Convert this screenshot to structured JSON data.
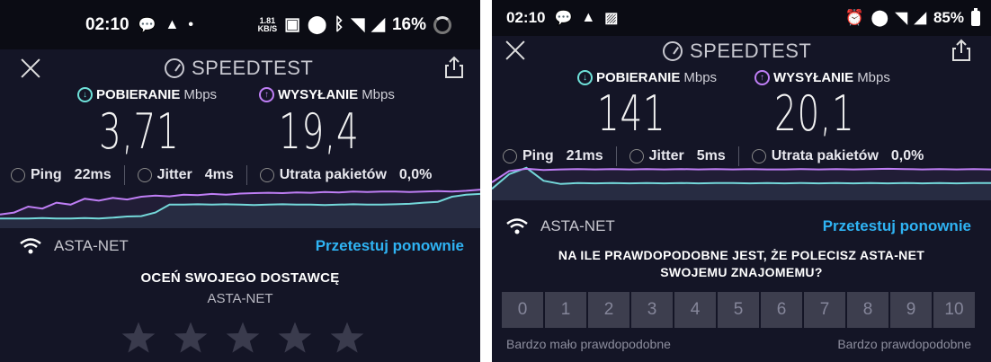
{
  "screens": [
    {
      "status": {
        "time": "02:10",
        "net_speed_top": "1.81",
        "net_speed_unit": "KB/S",
        "battery": "16%"
      },
      "app": {
        "brand": "SPEEDTEST"
      },
      "download": {
        "label": "POBIERANIE",
        "unit": "Mbps",
        "value": "3,71"
      },
      "upload": {
        "label": "WYSYŁANIE",
        "unit": "Mbps",
        "value": "19,4"
      },
      "ping": {
        "label": "Ping",
        "value": "22ms"
      },
      "jitter": {
        "label": "Jitter",
        "value": "4ms"
      },
      "loss": {
        "label": "Utrata pakietów",
        "value": "0,0%"
      },
      "network": {
        "name": "ASTA-NET",
        "retest": "Przetestuj ponownie"
      },
      "rate": {
        "title": "OCEŃ SWOJEGO DOSTAWCĘ",
        "subtitle": "ASTA-NET",
        "stars_max": 5
      }
    },
    {
      "status": {
        "time": "02:10",
        "battery": "85%"
      },
      "app": {
        "brand": "SPEEDTEST"
      },
      "download": {
        "label": "POBIERANIE",
        "unit": "Mbps",
        "value": "141"
      },
      "upload": {
        "label": "WYSYŁANIE",
        "unit": "Mbps",
        "value": "20,1"
      },
      "ping": {
        "label": "Ping",
        "value": "21ms"
      },
      "jitter": {
        "label": "Jitter",
        "value": "5ms"
      },
      "loss": {
        "label": "Utrata pakietów",
        "value": "0,0%"
      },
      "network": {
        "name": "ASTA-NET",
        "retest": "Przetestuj ponownie"
      },
      "nps": {
        "question_line1": "NA ILE PRAWDOPODOBNE JEST, ŻE POLECISZ ASTA-NET",
        "question_line2": "SWOJEMU ZNAJOMEMU?",
        "scale": [
          "0",
          "1",
          "2",
          "3",
          "4",
          "5",
          "6",
          "7",
          "8",
          "9",
          "10"
        ],
        "low_label": "Bardzo mało prawdopodobne",
        "high_label": "Bardzo prawdopodobne"
      }
    }
  ],
  "colors": {
    "download": "#6ee0d8",
    "upload": "#bf7ef5",
    "link": "#2fb3f3",
    "background": "#141526"
  },
  "graphs": {
    "left_upload": [
      0.3,
      0.35,
      0.5,
      0.45,
      0.6,
      0.55,
      0.7,
      0.65,
      0.72,
      0.68,
      0.75,
      0.78,
      0.76,
      0.8,
      0.79,
      0.82,
      0.8,
      0.83,
      0.84,
      0.85,
      0.84,
      0.86,
      0.85,
      0.87,
      0.86,
      0.88,
      0.87,
      0.88,
      0.88,
      0.87,
      0.88,
      0.89,
      0.88,
      0.9,
      0.93
    ],
    "left_download": [
      0.2,
      0.2,
      0.2,
      0.21,
      0.2,
      0.2,
      0.21,
      0.2,
      0.22,
      0.25,
      0.26,
      0.35,
      0.55,
      0.55,
      0.56,
      0.55,
      0.56,
      0.55,
      0.54,
      0.55,
      0.56,
      0.55,
      0.55,
      0.54,
      0.55,
      0.56,
      0.55,
      0.55,
      0.56,
      0.57,
      0.6,
      0.62,
      0.75,
      0.8,
      0.82
    ],
    "right_upload": [
      0.5,
      0.85,
      0.92,
      0.88,
      0.9,
      0.91,
      0.9,
      0.91,
      0.9,
      0.91,
      0.9,
      0.91,
      0.9,
      0.91,
      0.9,
      0.91,
      0.9,
      0.9,
      0.91,
      0.9,
      0.91,
      0.9,
      0.91,
      0.92,
      0.91,
      0.9,
      0.91,
      0.9,
      0.91,
      0.9
    ],
    "right_download": [
      0.3,
      0.75,
      0.95,
      0.55,
      0.45,
      0.48,
      0.47,
      0.48,
      0.47,
      0.48,
      0.47,
      0.48,
      0.47,
      0.48,
      0.48,
      0.47,
      0.48,
      0.47,
      0.48,
      0.47,
      0.48,
      0.47,
      0.48,
      0.47,
      0.48,
      0.47,
      0.48,
      0.47,
      0.48,
      0.48
    ]
  }
}
